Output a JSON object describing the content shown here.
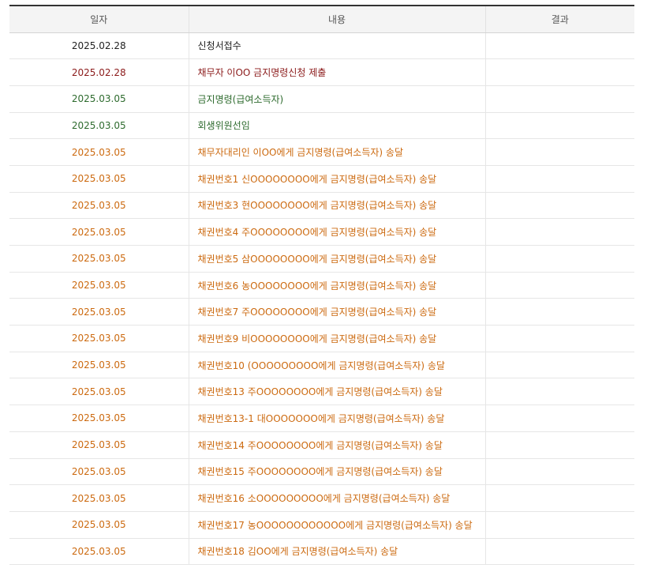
{
  "table": {
    "headers": {
      "date": "일자",
      "content": "내용",
      "result": "결과"
    },
    "colors": {
      "black": "#222222",
      "red": "#8b1a1a",
      "green": "#2e6b2e",
      "orange": "#cc6a10"
    },
    "rows": [
      {
        "date": "2025.02.28",
        "content": "신청서접수",
        "result": "",
        "status": "black"
      },
      {
        "date": "2025.02.28",
        "content": "채무자 이OO 금지명령신청 제출",
        "result": "",
        "status": "red"
      },
      {
        "date": "2025.03.05",
        "content": "금지명령(급여소득자)",
        "result": "",
        "status": "green"
      },
      {
        "date": "2025.03.05",
        "content": "회생위원선임",
        "result": "",
        "status": "green"
      },
      {
        "date": "2025.03.05",
        "content": "채무자대리인 이OO에게 금지명령(급여소득자) 송달",
        "result": "",
        "status": "orange"
      },
      {
        "date": "2025.03.05",
        "content": "채권번호1 신OOOOOOOO에게 금지명령(급여소득자) 송달",
        "result": "",
        "status": "orange"
      },
      {
        "date": "2025.03.05",
        "content": "채권번호3 현OOOOOOOO에게 금지명령(급여소득자) 송달",
        "result": "",
        "status": "orange"
      },
      {
        "date": "2025.03.05",
        "content": "채권번호4 주OOOOOOOO에게 금지명령(급여소득자) 송달",
        "result": "",
        "status": "orange"
      },
      {
        "date": "2025.03.05",
        "content": "채권번호5 삼OOOOOOOO에게 금지명령(급여소득자) 송달",
        "result": "",
        "status": "orange"
      },
      {
        "date": "2025.03.05",
        "content": "채권번호6 농OOOOOOOO에게 금지명령(급여소득자) 송달",
        "result": "",
        "status": "orange"
      },
      {
        "date": "2025.03.05",
        "content": "채권번호7 주OOOOOOOO에게 금지명령(급여소득자) 송달",
        "result": "",
        "status": "orange"
      },
      {
        "date": "2025.03.05",
        "content": "채권번호9 비OOOOOOOO에게 금지명령(급여소득자) 송달",
        "result": "",
        "status": "orange"
      },
      {
        "date": "2025.03.05",
        "content": "채권번호10 (OOOOOOOOO에게 금지명령(급여소득자) 송달",
        "result": "",
        "status": "orange"
      },
      {
        "date": "2025.03.05",
        "content": "채권번호13 주OOOOOOOO에게 금지명령(급여소득자) 송달",
        "result": "",
        "status": "orange"
      },
      {
        "date": "2025.03.05",
        "content": "채권번호13-1 대OOOOOOO에게 금지명령(급여소득자) 송달",
        "result": "",
        "status": "orange"
      },
      {
        "date": "2025.03.05",
        "content": "채권번호14 주OOOOOOOO에게 금지명령(급여소득자) 송달",
        "result": "",
        "status": "orange"
      },
      {
        "date": "2025.03.05",
        "content": "채권번호15 주OOOOOOOO에게 금지명령(급여소득자) 송달",
        "result": "",
        "status": "orange"
      },
      {
        "date": "2025.03.05",
        "content": "채권번호16 소OOOOOOOOO에게 금지명령(급여소득자) 송달",
        "result": "",
        "status": "orange"
      },
      {
        "date": "2025.03.05",
        "content": "채권번호17 농OOOOOOOOOOOO에게 금지명령(급여소득자) 송달",
        "result": "",
        "status": "orange"
      },
      {
        "date": "2025.03.05",
        "content": "채권번호18 김OO에게 금지명령(급여소득자) 송달",
        "result": "",
        "status": "orange"
      }
    ]
  }
}
